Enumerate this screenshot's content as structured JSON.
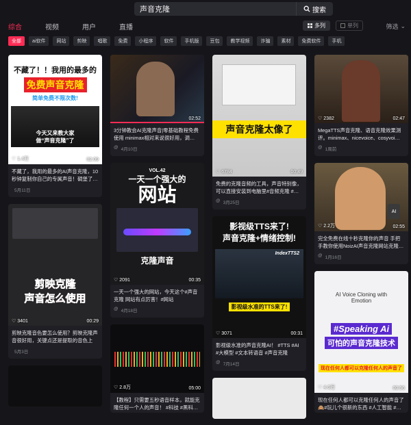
{
  "search": {
    "value": "声音克隆",
    "button_label": "搜索"
  },
  "tabs": [
    {
      "label": "综合",
      "active": true
    },
    {
      "label": "视频",
      "active": false
    },
    {
      "label": "用户",
      "active": false
    },
    {
      "label": "直播",
      "active": false
    }
  ],
  "view_toggle": {
    "multi_label": "多列",
    "single_label": "单列",
    "active": "multi"
  },
  "filter_label": "筛选",
  "chips": [
    "全部",
    "ai软件",
    "网站",
    "剪映",
    "唱歌",
    "免费",
    "小程序",
    "软件",
    "手机版",
    "豆包",
    "教学视频",
    "诈骗",
    "素材",
    "免费软件",
    "手机"
  ],
  "active_chip": "全部",
  "columns": [
    [
      {
        "thumb_lines": [
          "不藏了！！我用的最多的",
          "免费声音克隆",
          "简单免费不限次数!",
          "今天又来教大家",
          "做“声音克隆”了"
        ],
        "likes": "1.4万",
        "duration": "02:09",
        "desc": "不藏了，我用的最多的AI声音克隆，10秒钟复制你自己的专属声音！碉堡了…",
        "author": "",
        "date": "5月11日"
      },
      {
        "thumb_lines": [
          "剪映克隆",
          "声音怎么使用"
        ],
        "likes": "3401",
        "duration": "00:29",
        "desc": "剪映克隆音色要怎么使用？剪映克隆声音很好用，关键点还是提取的音色上面…",
        "author": "",
        "date": "5月3日"
      },
      {
        "thumb_lines": [],
        "likes": "",
        "duration": "",
        "desc": "",
        "author": "",
        "date": ""
      }
    ],
    [
      {
        "thumb_lines": [],
        "likes": "",
        "duration": "02:52",
        "desc": "3分钟教会AI克隆声音|零基础教程免费使用 minimax相对来说很好用，调…",
        "author": "@",
        "date": "4月10日"
      },
      {
        "thumb_lines": [
          "VOL.42",
          "一天一个强大的",
          "网站",
          "克隆声音"
        ],
        "likes": "2091",
        "duration": "00:35",
        "desc": "一天一个强大的网站，今天这个#声音克隆 网站有点厉害！#网站",
        "author": "@",
        "date": "4月18日"
      },
      {
        "thumb_lines": [],
        "likes": "2.8万",
        "duration": "05:00",
        "desc": "【教程】只需要五秒语音样本，就能克隆任何一个人的声音！ #科技 #黑科…",
        "author": "",
        "date": ""
      }
    ],
    [
      {
        "thumb_lines": [
          "声音克隆太像了"
        ],
        "likes": "6784",
        "duration": "00:49",
        "desc": "免费的克隆音频的工具，声音特别像，可以直接安装到电脑里#音频克隆 #…",
        "author": "@",
        "date": "3月25日"
      },
      {
        "thumb_lines": [
          "影视级TTS来了!",
          "声音克隆+情绪控制!",
          "IndexTTS2",
          "影视级水准的TTS来了!"
        ],
        "likes": "3071",
        "duration": "00:31",
        "desc": "影视级水准的声音克隆AI！ #TTS #AI #大模型 #文本转语音 #声音克隆",
        "author": "@",
        "date": "7月14日"
      },
      {
        "thumb_lines": [],
        "likes": "",
        "duration": "",
        "desc": "",
        "author": "",
        "date": ""
      }
    ],
    [
      {
        "thumb_lines": [],
        "likes": "2382",
        "duration": "02:47",
        "desc": "MegaTTS声音克隆、语音克隆效果测评。minimax、nicevoice、cosyvoi…",
        "author": "@",
        "date": "1周前"
      },
      {
        "thumb_lines": [
          "AI"
        ],
        "likes": "2.2万",
        "duration": "02:55",
        "desc": "完全免费在线十秒克隆你的声音 手把手教你使用NoizAI声音克隆网站克隆…",
        "author": "@",
        "date": "1月16日"
      },
      {
        "thumb_lines": [
          "AI Voice Cloning with Emotion",
          "#Speaking Ai",
          "可怕的声音克隆技术",
          "现在任何人都可以克隆任何人的声音了"
        ],
        "likes": "4.6万",
        "duration": "00:56",
        "desc": "现在任何人都可以克隆任何人的声音了🙈#玩儿个很新的东西 #人工智能 #…",
        "author": "",
        "date": ""
      }
    ]
  ]
}
